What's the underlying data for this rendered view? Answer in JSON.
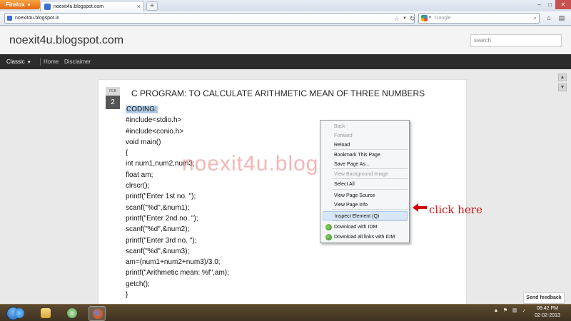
{
  "browser": {
    "app_button": "Firefox",
    "tab_title": "noexit4u.blogspot.com",
    "new_tab_label": "+",
    "url": "noexit4u.blogspot.in",
    "search_placeholder": "Google",
    "window_controls": [
      "–",
      "□",
      "✕"
    ]
  },
  "site": {
    "title": "noexit4u.blogspot.com",
    "search_placeholder": "search",
    "nav": {
      "view": "Classic",
      "items": [
        "Home",
        "Disclaimer"
      ]
    }
  },
  "post": {
    "date_month": "FEB",
    "date_day": "2",
    "title": "C PROGRAM: TO CALCULATE ARITHMETIC MEAN OF THREE NUMBERS",
    "code_lines": [
      "CODING:",
      "#include<stdio.h>",
      "#include<conio.h>",
      "void main()",
      "{",
      "int num1,num2,num3;",
      "float am;",
      "clrscr();",
      "printf(\"Enter 1st no. \");",
      "scanf(\"%d\",&num1);",
      "printf(\"Enter 2nd no. \");",
      "scanf(\"%d\",&num2);",
      "printf(\"Enter 3rd no. \");",
      "scanf(\"%d\",&num3);",
      "am=(num1+num2+num3)/3.0;",
      "printf(\"Arithmetic mean: %f\",am);",
      "getch();",
      "}"
    ]
  },
  "watermark": "noexit4u.blogspot.com",
  "context_menu": {
    "items": [
      {
        "label": "Back",
        "disabled": true
      },
      {
        "label": "Forward",
        "disabled": true
      },
      {
        "label": "Reload",
        "disabled": false
      },
      {
        "label": "Bookmark This Page",
        "disabled": false
      },
      {
        "label": "Save Page As...",
        "disabled": false
      },
      {
        "label": "View Background Image",
        "disabled": true
      },
      {
        "label": "Select All",
        "disabled": false
      },
      {
        "label": "View Page Source",
        "disabled": false
      },
      {
        "label": "View Page Info",
        "disabled": false
      },
      {
        "label": "Inspect Element (Q)",
        "disabled": false,
        "highlighted": true
      },
      {
        "label": "Download with IDM",
        "disabled": false
      },
      {
        "label": "Download all links with IDM",
        "disabled": false
      }
    ]
  },
  "annotation": "click here",
  "send_feedback": "Send feedback",
  "taskbar": {
    "time": "08:42 PM",
    "date": "02-02-2013"
  }
}
